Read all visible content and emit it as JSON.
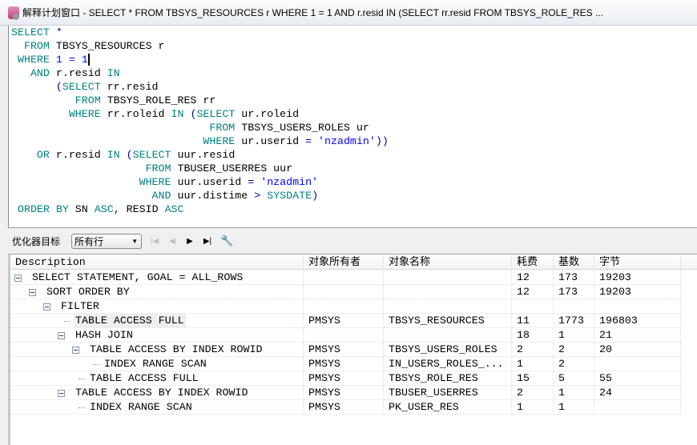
{
  "window": {
    "title": "解释计划窗口 - SELECT * FROM TBSYS_RESOURCES r WHERE 1 = 1 AND r.resid IN (SELECT rr.resid FROM TBSYS_ROLE_RES  ...",
    "icon": "database-icon"
  },
  "colors": {
    "keyword": "#008080",
    "string": "#0000ff",
    "operator": "#0000a0"
  },
  "sql_lines": [
    [
      [
        "kw",
        "SELECT "
      ],
      [
        "op",
        "*"
      ]
    ],
    [
      [
        "kw",
        "  FROM "
      ],
      [
        "id",
        "TBSYS_RESOURCES r"
      ]
    ],
    [
      [
        "kw",
        " WHERE "
      ],
      [
        "num",
        "1 = 1"
      ],
      [
        "caret",
        ""
      ]
    ],
    [
      [
        "kw",
        "   AND "
      ],
      [
        "id",
        "r.resid "
      ],
      [
        "kw",
        "IN"
      ]
    ],
    [
      [
        "op",
        "       ("
      ],
      [
        "kw",
        "SELECT "
      ],
      [
        "id",
        "rr.resid"
      ]
    ],
    [
      [
        "kw",
        "          FROM "
      ],
      [
        "id",
        "TBSYS_ROLE_RES rr"
      ]
    ],
    [
      [
        "kw",
        "         WHERE "
      ],
      [
        "id",
        "rr.roleid "
      ],
      [
        "kw",
        "IN "
      ],
      [
        "op",
        "("
      ],
      [
        "kw",
        "SELECT "
      ],
      [
        "id",
        "ur.roleid"
      ]
    ],
    [
      [
        "kw",
        "                               FROM "
      ],
      [
        "id",
        "TBSYS_USERS_ROLES ur"
      ]
    ],
    [
      [
        "kw",
        "                              WHERE "
      ],
      [
        "id",
        "ur.userid "
      ],
      [
        "op",
        "= "
      ],
      [
        "str",
        "'nzadmin'"
      ],
      [
        "op",
        "))"
      ]
    ],
    [
      [
        "kw",
        "    OR "
      ],
      [
        "id",
        "r.resid "
      ],
      [
        "kw",
        "IN "
      ],
      [
        "op",
        "("
      ],
      [
        "kw",
        "SELECT "
      ],
      [
        "id",
        "uur.resid"
      ]
    ],
    [
      [
        "kw",
        "                     FROM "
      ],
      [
        "id",
        "TBUSER_USERRES uur"
      ]
    ],
    [
      [
        "kw",
        "                    WHERE "
      ],
      [
        "id",
        "uur.userid "
      ],
      [
        "op",
        "= "
      ],
      [
        "str",
        "'nzadmin'"
      ]
    ],
    [
      [
        "kw",
        "                      AND "
      ],
      [
        "id",
        "uur.distime "
      ],
      [
        "op",
        "> "
      ],
      [
        "kw",
        "SYSDATE"
      ],
      [
        "op",
        ")"
      ]
    ],
    [
      [
        "kw",
        " ORDER BY "
      ],
      [
        "id",
        "SN "
      ],
      [
        "kw",
        "ASC"
      ],
      [
        "op",
        ", "
      ],
      [
        "id",
        "RESID "
      ],
      [
        "kw",
        "ASC"
      ]
    ]
  ],
  "toolbar": {
    "optimizer_label": "优化器目标",
    "goal_value": "所有行"
  },
  "plan": {
    "columns": [
      "Description",
      "对象所有者",
      "对象名称",
      "耗费",
      "基数",
      "字节"
    ],
    "rows": [
      {
        "level": 0,
        "expanded": true,
        "desc": "SELECT STATEMENT, GOAL = ALL_ROWS",
        "owner": "",
        "object": "",
        "cost": "12",
        "card": "173",
        "bytes": "19203"
      },
      {
        "level": 1,
        "expanded": true,
        "desc": "SORT ORDER BY",
        "owner": "",
        "object": "",
        "cost": "12",
        "card": "173",
        "bytes": "19203"
      },
      {
        "level": 2,
        "expanded": true,
        "desc": "FILTER",
        "owner": "",
        "object": "",
        "cost": "",
        "card": "",
        "bytes": ""
      },
      {
        "level": 3,
        "expanded": null,
        "selected": true,
        "desc": "TABLE ACCESS FULL",
        "owner": "PMSYS",
        "object": "TBSYS_RESOURCES",
        "cost": "11",
        "card": "1773",
        "bytes": "196803"
      },
      {
        "level": 3,
        "expanded": true,
        "desc": "HASH JOIN",
        "owner": "",
        "object": "",
        "cost": "18",
        "card": "1",
        "bytes": "21"
      },
      {
        "level": 4,
        "expanded": true,
        "desc": "TABLE ACCESS BY INDEX ROWID",
        "owner": "PMSYS",
        "object": "TBSYS_USERS_ROLES",
        "cost": "2",
        "card": "2",
        "bytes": "20"
      },
      {
        "level": 5,
        "expanded": null,
        "desc": "INDEX RANGE SCAN",
        "owner": "PMSYS",
        "object": "IN_USERS_ROLES_...",
        "cost": "1",
        "card": "2",
        "bytes": ""
      },
      {
        "level": 4,
        "expanded": null,
        "desc": "TABLE ACCESS FULL",
        "owner": "PMSYS",
        "object": "TBSYS_ROLE_RES",
        "cost": "15",
        "card": "5",
        "bytes": "55"
      },
      {
        "level": 3,
        "expanded": true,
        "desc": "TABLE ACCESS BY INDEX ROWID",
        "owner": "PMSYS",
        "object": "TBUSER_USERRES",
        "cost": "2",
        "card": "1",
        "bytes": "24"
      },
      {
        "level": 4,
        "expanded": null,
        "desc": "INDEX RANGE SCAN",
        "owner": "PMSYS",
        "object": "PK_USER_RES",
        "cost": "1",
        "card": "1",
        "bytes": ""
      }
    ]
  }
}
